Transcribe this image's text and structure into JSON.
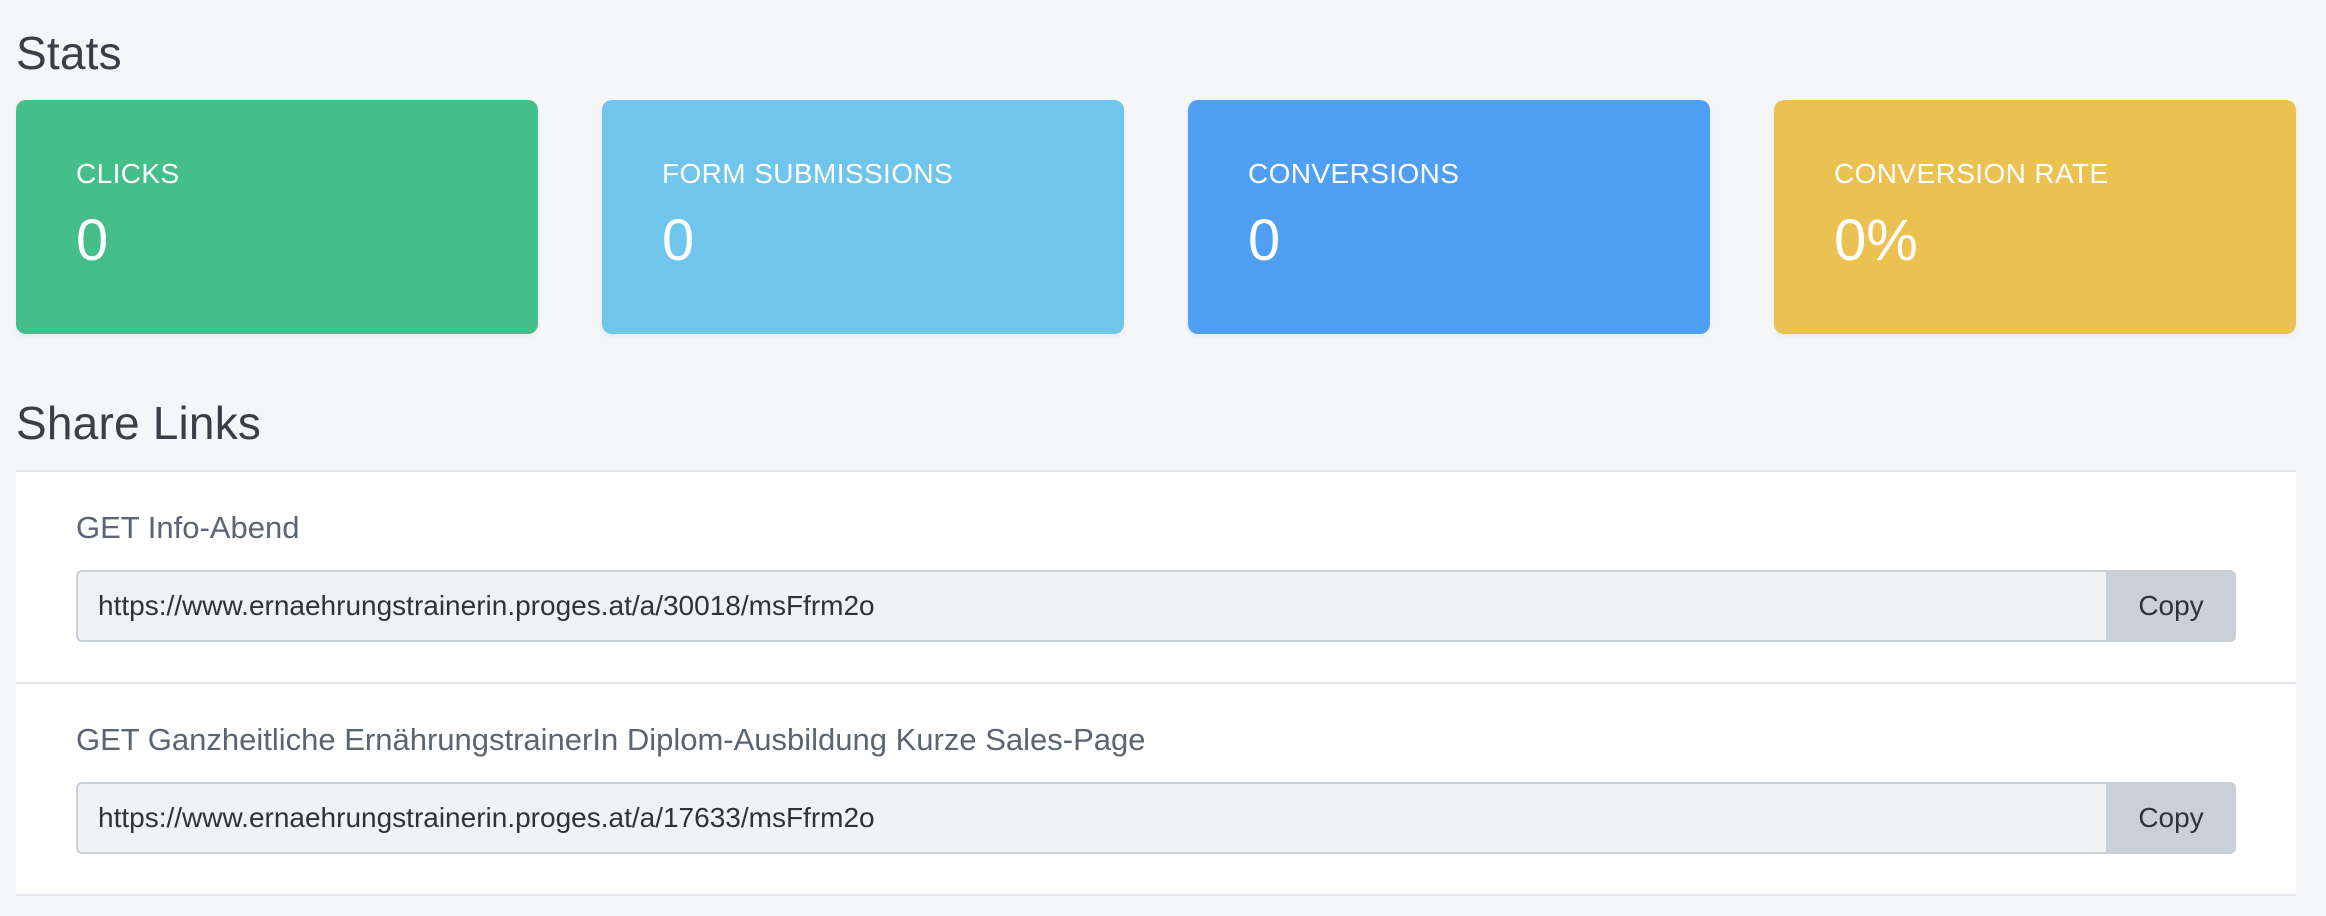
{
  "stats": {
    "title": "Stats",
    "cards": [
      {
        "label": "CLICKS",
        "value": "0",
        "color": "#44bf8a"
      },
      {
        "label": "FORM SUBMISSIONS",
        "value": "0",
        "color": "#6fc5ec"
      },
      {
        "label": "CONVERSIONS",
        "value": "0",
        "color": "#4f9ff4"
      },
      {
        "label": "CONVERSION RATE",
        "value": "0%",
        "color": "#ebc251"
      }
    ]
  },
  "share_links": {
    "title": "Share Links",
    "items": [
      {
        "title": "GET Info-Abend",
        "url": "https://www.ernaehrungstrainerin.proges.at/a/30018/msFfrm2o",
        "copy_label": "Copy"
      },
      {
        "title": "GET Ganzheitliche ErnährungstrainerIn Diplom-Ausbildung Kurze Sales-Page",
        "url": "https://www.ernaehrungstrainerin.proges.at/a/17633/msFfrm2o",
        "copy_label": "Copy"
      }
    ]
  }
}
